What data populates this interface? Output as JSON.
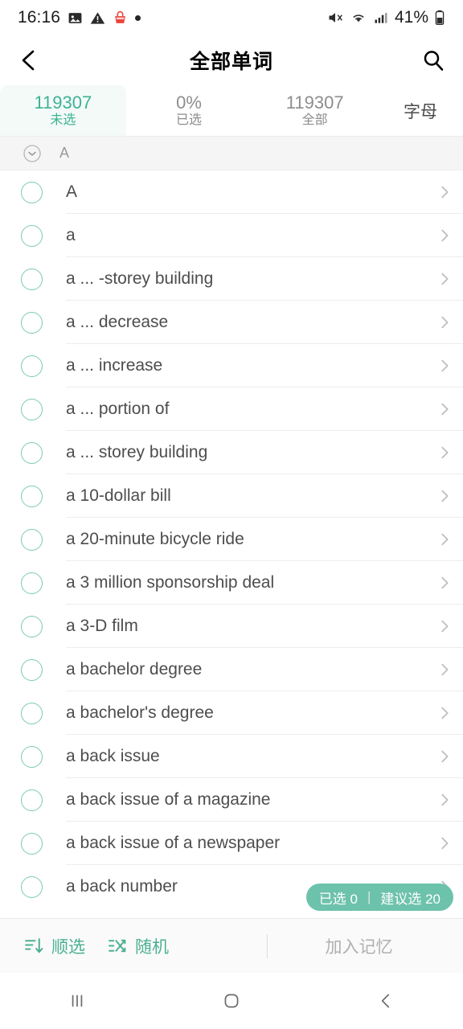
{
  "status_bar": {
    "time": "16:16",
    "battery_percent": "41%",
    "icons": [
      "image-icon",
      "warning-icon",
      "shopping-basket-icon",
      "dot-icon",
      "mute-icon",
      "wifi-icon",
      "signal-icon",
      "battery-icon"
    ]
  },
  "header": {
    "title": "全部单词",
    "back_icon": "back-chevron-icon",
    "search_icon": "search-icon"
  },
  "tabs": [
    {
      "value": "119307",
      "label": "未选",
      "active": true
    },
    {
      "value": "0%",
      "label": "已选",
      "active": false
    },
    {
      "value": "119307",
      "label": "全部",
      "active": false
    }
  ],
  "sort_control": {
    "label": "字母"
  },
  "section": {
    "collapse_icon": "chevron-down-circle-icon",
    "letter": "A"
  },
  "words": [
    "A",
    "a",
    "a ... -storey building",
    "a ... decrease",
    "a ... increase",
    "a ... portion of",
    "a ... storey building",
    "a 10-dollar bill",
    "a 20-minute bicycle ride",
    "a 3 million sponsorship deal",
    "a 3-D film",
    "a bachelor degree",
    "a bachelor's degree",
    "a back issue",
    "a back issue of a magazine",
    "a back issue of a newspaper",
    "a back number"
  ],
  "selection_badge": {
    "selected_label": "已选 0",
    "separator": "|",
    "suggested_label": "建议选 20"
  },
  "toolbar": {
    "sort_label": "顺选",
    "sort_icon": "sort-descending-icon",
    "random_label": "随机",
    "random_icon": "shuffle-icon",
    "action_label": "加入记忆"
  },
  "nav_bar": {
    "recents_icon": "recents-icon",
    "home_icon": "home-icon",
    "back_icon": "back-icon"
  },
  "colors": {
    "accent": "#3db394",
    "badge": "#6dc2ab",
    "checkbox_border": "#7cc9b4",
    "active_tab_bg": "#f3faf8"
  }
}
